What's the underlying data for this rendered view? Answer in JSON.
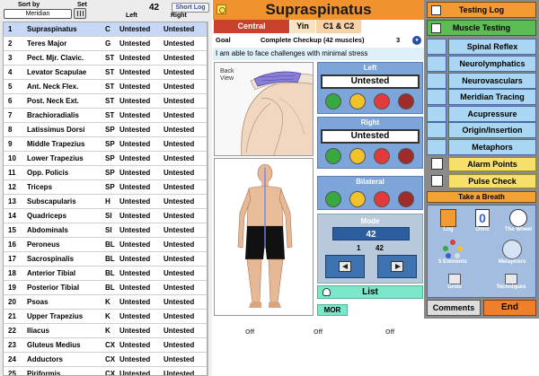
{
  "left_panel": {
    "sort_by_label": "Sort by",
    "set_label": "Set",
    "sort_value": "Meridian",
    "count": "42",
    "short_log_label": "Short Log",
    "col_left": "Left",
    "col_right": "Right",
    "rows": [
      {
        "n": "1",
        "name": "Supraspinatus",
        "mer": "C",
        "l": "Untested",
        "r": "Untested"
      },
      {
        "n": "2",
        "name": "Teres Major",
        "mer": "G",
        "l": "Untested",
        "r": "Untested"
      },
      {
        "n": "3",
        "name": "Pect. Mjr. Clavic.",
        "mer": "ST",
        "l": "Untested",
        "r": "Untested"
      },
      {
        "n": "4",
        "name": "Levator Scapulae",
        "mer": "ST",
        "l": "Untested",
        "r": "Untested"
      },
      {
        "n": "5",
        "name": "Ant. Neck Flex.",
        "mer": "ST",
        "l": "Untested",
        "r": "Untested"
      },
      {
        "n": "6",
        "name": "Post. Neck Ext.",
        "mer": "ST",
        "l": "Untested",
        "r": "Untested"
      },
      {
        "n": "7",
        "name": "Brachioradialis",
        "mer": "ST",
        "l": "Untested",
        "r": "Untested"
      },
      {
        "n": "8",
        "name": "Latissimus Dorsi",
        "mer": "SP",
        "l": "Untested",
        "r": "Untested"
      },
      {
        "n": "9",
        "name": "Middle Trapezius",
        "mer": "SP",
        "l": "Untested",
        "r": "Untested"
      },
      {
        "n": "10",
        "name": "Lower Trapezius",
        "mer": "SP",
        "l": "Untested",
        "r": "Untested"
      },
      {
        "n": "11",
        "name": "Opp. Policis",
        "mer": "SP",
        "l": "Untested",
        "r": "Untested"
      },
      {
        "n": "12",
        "name": "Triceps",
        "mer": "SP",
        "l": "Untested",
        "r": "Untested"
      },
      {
        "n": "13",
        "name": "Subscapularis",
        "mer": "H",
        "l": "Untested",
        "r": "Untested"
      },
      {
        "n": "14",
        "name": "Quadriceps",
        "mer": "SI",
        "l": "Untested",
        "r": "Untested"
      },
      {
        "n": "15",
        "name": "Abdominals",
        "mer": "SI",
        "l": "Untested",
        "r": "Untested"
      },
      {
        "n": "16",
        "name": "Peroneus",
        "mer": "BL",
        "l": "Untested",
        "r": "Untested"
      },
      {
        "n": "17",
        "name": "Sacrospinalis",
        "mer": "BL",
        "l": "Untested",
        "r": "Untested"
      },
      {
        "n": "18",
        "name": "Anterior Tibial",
        "mer": "BL",
        "l": "Untested",
        "r": "Untested"
      },
      {
        "n": "19",
        "name": "Posterior Tibial",
        "mer": "BL",
        "l": "Untested",
        "r": "Untested"
      },
      {
        "n": "20",
        "name": "Psoas",
        "mer": "K",
        "l": "Untested",
        "r": "Untested"
      },
      {
        "n": "21",
        "name": "Upper Trapezius",
        "mer": "K",
        "l": "Untested",
        "r": "Untested"
      },
      {
        "n": "22",
        "name": "Iliacus",
        "mer": "K",
        "l": "Untested",
        "r": "Untested"
      },
      {
        "n": "23",
        "name": "Gluteus Medius",
        "mer": "CX",
        "l": "Untested",
        "r": "Untested"
      },
      {
        "n": "24",
        "name": "Adductors",
        "mer": "CX",
        "l": "Untested",
        "r": "Untested"
      },
      {
        "n": "25",
        "name": "Piriformis",
        "mer": "CX",
        "l": "Untested",
        "r": "Untested"
      }
    ]
  },
  "middle": {
    "title": "Supraspinatus",
    "central": "Central",
    "yin": "Yin",
    "vertebra": "C1 & C2",
    "goal_label": "Goal",
    "goal_value": "Complete Checkup (42 muscles)",
    "goal_count": "3",
    "affirmation": "I am able to face challenges with minimal stress",
    "back_view": "Back View",
    "left_label": "Left",
    "left_status": "Untested",
    "right_label": "Right",
    "right_status": "Untested",
    "bilateral_label": "Bilateral",
    "mode_label": "Mode",
    "mode_value": "42",
    "page_current": "1",
    "page_total": "42",
    "list_label": "List",
    "mor_label": "MOR",
    "off_labels": [
      "Off",
      "Off",
      "Off"
    ]
  },
  "right_panel": {
    "testing_log": "Testing Log",
    "muscle_testing": "Muscle Testing",
    "lookup_buttons": [
      "Spinal Reflex",
      "Neurolymphatics",
      "Neurovasculars",
      "Meridian Tracing",
      "Acupressure",
      "Origin/Insertion",
      "Metaphors"
    ],
    "alarm_points": "Alarm Points",
    "pulse_check": "Pulse Check",
    "take_a_breath": "Take a Breath",
    "tools": {
      "log": "Log",
      "omni": "Omni",
      "omni_glyph": "0",
      "wheel": "The Wheel",
      "five_elements": "5 Elements",
      "metaphors": "Metaphors",
      "grids": "Grids",
      "techniques": "Techniques"
    },
    "comments": "Comments",
    "end": "End"
  },
  "colors": {
    "title_orange": "#f0932f",
    "central_red": "#c9412b",
    "side_blue": "#7da5d9",
    "lookup_blue": "#a9d6f2",
    "muscle_green": "#5cbd54",
    "alarm_yellow": "#f7e06a",
    "list_mint": "#7be6c9"
  }
}
